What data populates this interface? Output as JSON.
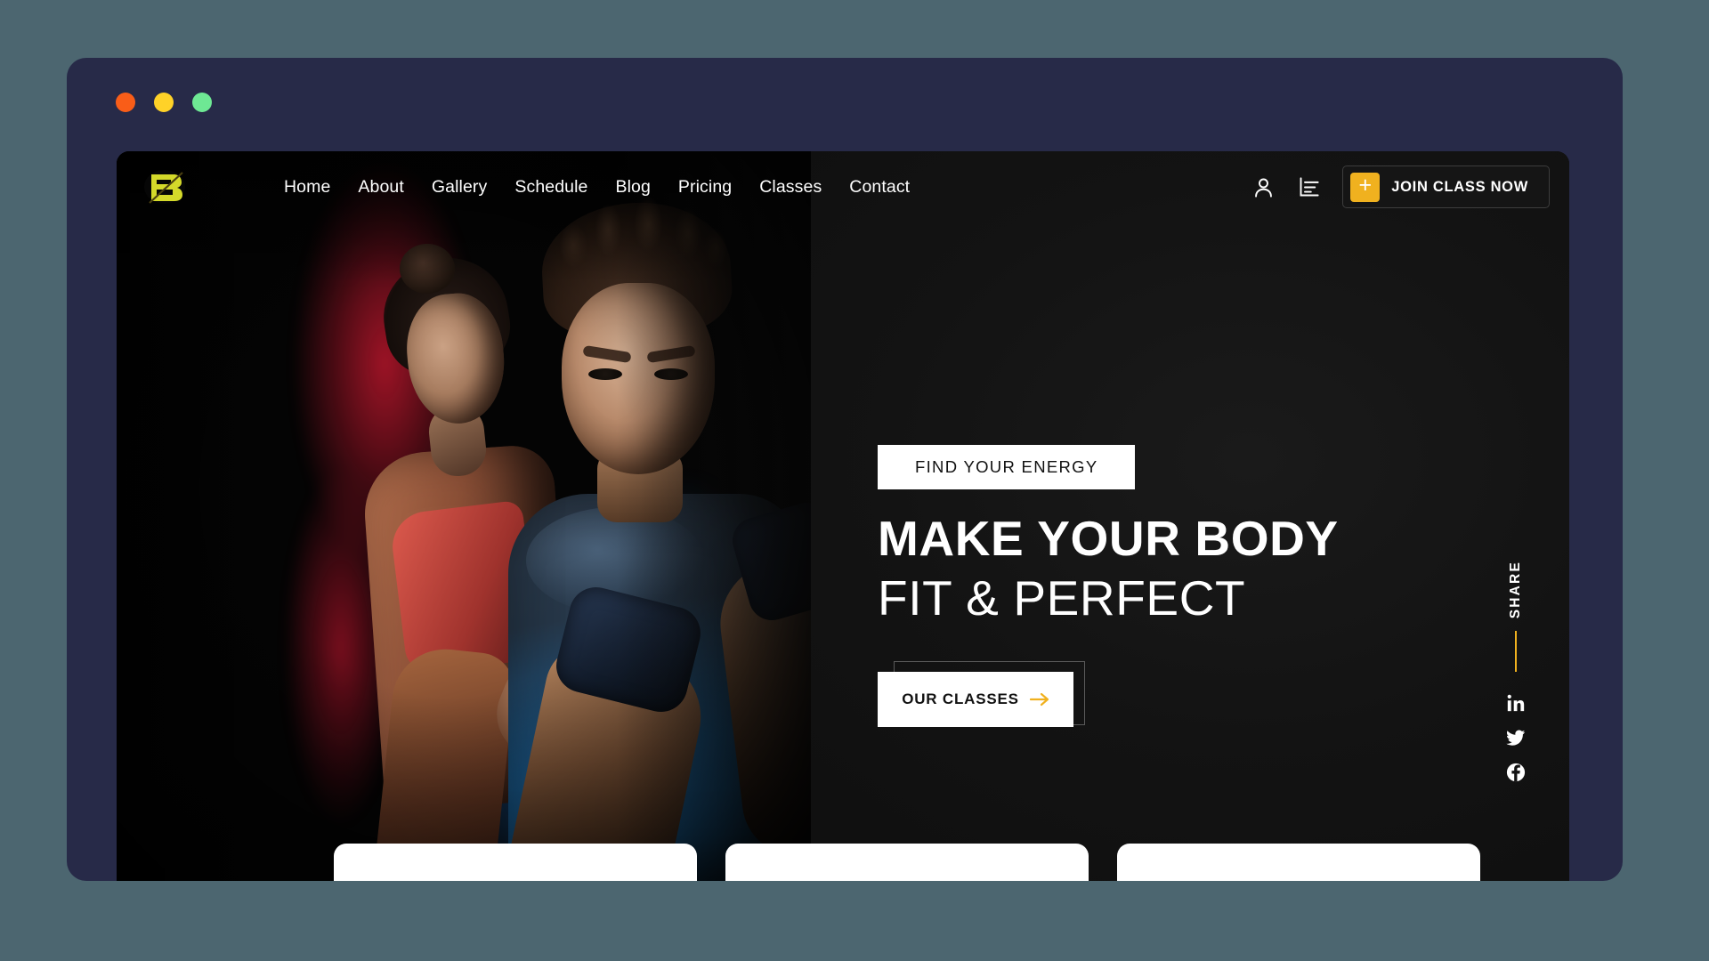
{
  "window": {
    "traffic_lights": [
      {
        "name": "close",
        "color": "#f95d18"
      },
      {
        "name": "minimize",
        "color": "#ffd228"
      },
      {
        "name": "maximize",
        "color": "#6ee894"
      }
    ],
    "chrome_color": "#272a48",
    "page_background": "#4c6670"
  },
  "brand": {
    "logo_name": "b-monogram-logo",
    "logo_color": "#d4d92a"
  },
  "nav": {
    "items": [
      {
        "label": "Home"
      },
      {
        "label": "About"
      },
      {
        "label": "Gallery"
      },
      {
        "label": "Schedule"
      },
      {
        "label": "Blog"
      },
      {
        "label": "Pricing"
      },
      {
        "label": "Classes"
      },
      {
        "label": "Contact"
      }
    ]
  },
  "header_actions": {
    "account_icon": "user-icon",
    "chart_icon": "bar-chart-icon",
    "join_button": {
      "plus": "+",
      "label": "JOIN CLASS NOW",
      "accent_color": "#f0b11f"
    }
  },
  "hero": {
    "eyebrow": "FIND YOUR ENERGY",
    "headline_strong": "MAKE YOUR BODY",
    "headline_light": "FIT & PERFECT",
    "cta_label": "OUR CLASSES",
    "cta_arrow_color": "#f0b11f",
    "background_color": "#121212"
  },
  "share": {
    "label": "SHARE",
    "divider_color": "#f0b11f",
    "networks": [
      {
        "name": "linkedin-icon"
      },
      {
        "name": "twitter-icon"
      },
      {
        "name": "facebook-icon"
      }
    ]
  },
  "bottom_cards": [
    {
      "name": "feature-card-1"
    },
    {
      "name": "feature-card-2"
    },
    {
      "name": "feature-card-3"
    }
  ]
}
